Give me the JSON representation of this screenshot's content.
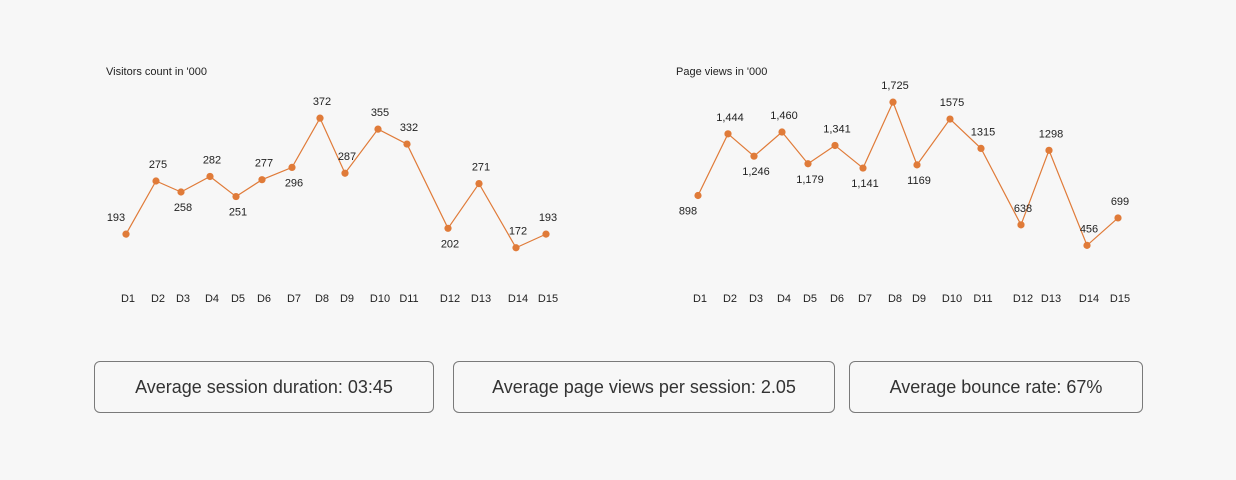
{
  "accent_color": "#e07b39",
  "chart_data": [
    {
      "type": "line",
      "title": "Visitors count in '000",
      "categories": [
        "D1",
        "D2",
        "D3",
        "D4",
        "D5",
        "D6",
        "D7",
        "D8",
        "D9",
        "D10",
        "D11",
        "D12",
        "D13",
        "D14",
        "D15"
      ],
      "values": [
        193,
        275,
        258,
        282,
        251,
        277,
        296,
        372,
        287,
        355,
        332,
        202,
        271,
        172,
        193
      ],
      "value_labels": [
        "193",
        "275",
        "258",
        "282",
        "251",
        "277",
        "296",
        "372",
        "287",
        "355",
        "332",
        "202",
        "271",
        "172",
        "193"
      ],
      "ylim": [
        150,
        400
      ],
      "grid": false,
      "legend": "none"
    },
    {
      "type": "line",
      "title": "Page views in '000",
      "categories": [
        "D1",
        "D2",
        "D3",
        "D4",
        "D5",
        "D6",
        "D7",
        "D8",
        "D9",
        "D10",
        "D11",
        "D12",
        "D13",
        "D14",
        "D15"
      ],
      "values": [
        898,
        1444,
        1246,
        1460,
        1179,
        1341,
        1141,
        1725,
        1169,
        1575,
        1315,
        638,
        1298,
        456,
        699
      ],
      "value_labels": [
        "898",
        "1,444",
        "1,246",
        "1,460",
        "1,179",
        "1,341",
        "1,141",
        "1,725",
        "1169",
        "1575",
        "1315",
        "638",
        "1298",
        "456",
        "699"
      ],
      "ylim": [
        300,
        1850
      ],
      "grid": false,
      "legend": "none"
    }
  ],
  "kpis": {
    "session_duration": "Average session duration: 03:45",
    "page_views_per_session": "Average page views per session: 2.05",
    "bounce_rate": "Average bounce rate: 67%"
  }
}
